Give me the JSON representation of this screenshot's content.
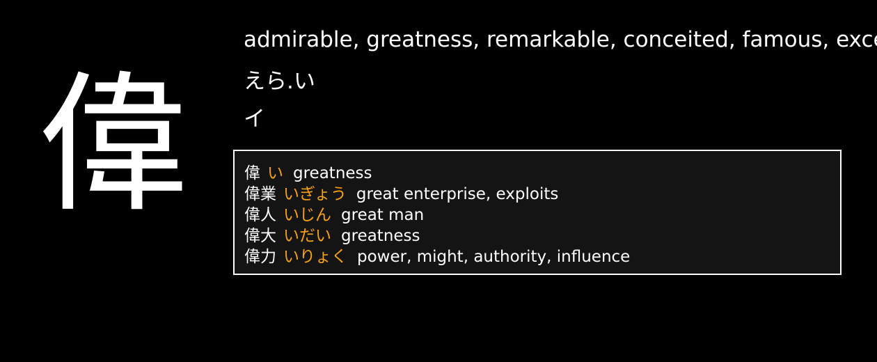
{
  "kanji": {
    "character": "偉",
    "meanings": "admirable, greatness, remarkable, conceited, famous, excellent",
    "kun_reading": "えら.い",
    "on_reading": "イ"
  },
  "examples": [
    {
      "word": "偉",
      "reading": "い",
      "gloss": "greatness"
    },
    {
      "word": "偉業",
      "reading": "いぎょう",
      "gloss": "great enterprise, exploits"
    },
    {
      "word": "偉人",
      "reading": "いじん",
      "gloss": "great man"
    },
    {
      "word": "偉大",
      "reading": "いだい",
      "gloss": "greatness"
    },
    {
      "word": "偉力",
      "reading": "いりょく",
      "gloss": "power, might, authority, influence"
    }
  ],
  "colors": {
    "background": "#000000",
    "text": "#ffffff",
    "reading_accent": "#f5a20e",
    "panel_background": "#141414",
    "panel_border": "#ffffff"
  }
}
